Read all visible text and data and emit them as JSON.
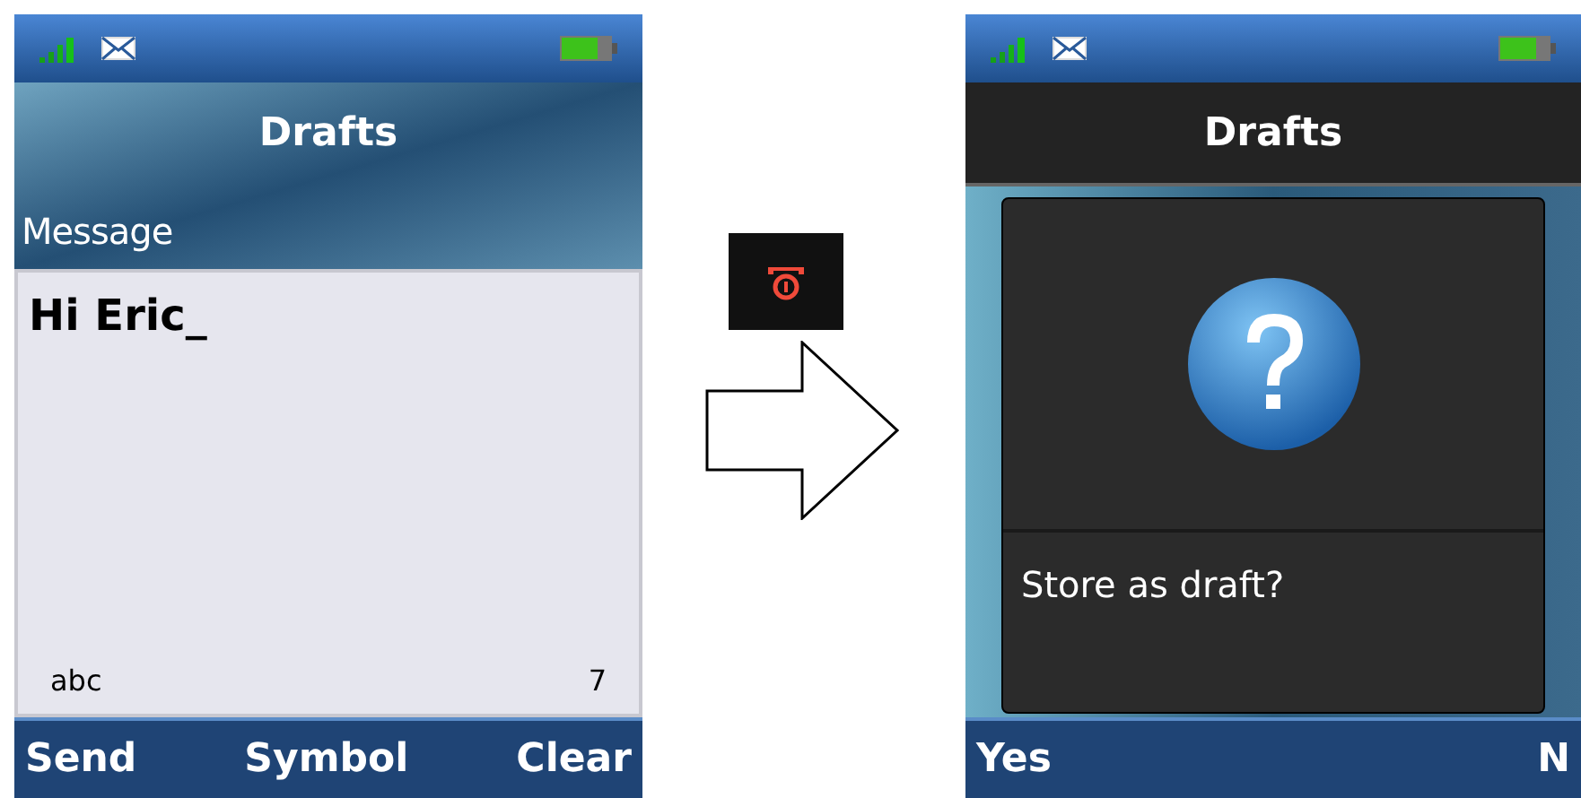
{
  "screens": [
    {
      "kind": "editor",
      "title": "Drafts",
      "field_label": "Message",
      "text": "Hi Eric_",
      "input_mode": "abc",
      "char_count": "7",
      "softkeys": [
        "Send",
        "Symbol",
        "Clear"
      ]
    },
    {
      "kind": "dialog",
      "title": "Drafts",
      "prompt": "Store as draft?",
      "softkeys": [
        "Yes",
        "N"
      ]
    }
  ]
}
